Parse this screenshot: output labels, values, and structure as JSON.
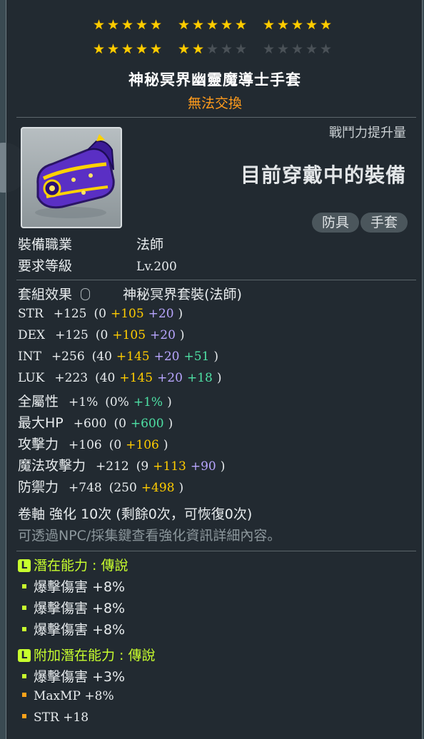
{
  "item": {
    "stars_row1": [
      true,
      true,
      true,
      true,
      true,
      true,
      true,
      true,
      true,
      true,
      true,
      true,
      true,
      true,
      true
    ],
    "stars_row2": [
      true,
      true,
      true,
      true,
      true,
      true,
      true,
      false,
      false,
      false,
      false,
      false,
      false,
      false,
      false
    ],
    "name": "神秘冥界幽靈魔導士手套",
    "trade_status": "無法交換",
    "combat_power_label": "戰鬥力提升量",
    "equipped_label": "目前穿戴中的裝備",
    "tags": [
      "防具",
      "手套"
    ],
    "job_label": "裝備職業",
    "job_value": "法師",
    "level_label": "要求等級",
    "level_value": "Lv.200",
    "set_label": "套組效果",
    "set_value": "神秘冥界套裝(法師)"
  },
  "stats": [
    {
      "name": "STR",
      "total": "+125",
      "base": "(0",
      "a": "+105",
      "b": "+20",
      "c": "",
      "end": ")"
    },
    {
      "name": "DEX",
      "total": "+125",
      "base": "(0",
      "a": "+105",
      "b": "+20",
      "c": "",
      "end": ")"
    },
    {
      "name": "INT",
      "total": "+256",
      "base": "(40",
      "a": "+145",
      "b": "+20",
      "c": "+51",
      "end": ")"
    },
    {
      "name": "LUK",
      "total": "+223",
      "base": "(40",
      "a": "+145",
      "b": "+20",
      "c": "+18",
      "end": ")"
    },
    {
      "name": "全屬性",
      "total": "+1%",
      "base": "(0%",
      "a": "",
      "b": "",
      "c": "+1%",
      "end": ")"
    },
    {
      "name": "最大HP",
      "total": "+600",
      "base": "(0",
      "a": "",
      "b": "",
      "c": "+600",
      "end": ")"
    },
    {
      "name": "攻擊力",
      "total": "+106",
      "base": "(0",
      "a": "+106",
      "b": "",
      "c": "",
      "end": ")"
    },
    {
      "name": "魔法攻擊力",
      "total": "+212",
      "base": "(9",
      "a": "+113",
      "b": "+90",
      "c": "",
      "end": ")"
    },
    {
      "name": "防禦力",
      "total": "+748",
      "base": "(250",
      "a": "+498",
      "b": "",
      "c": "",
      "end": ")"
    }
  ],
  "scroll": {
    "line": "卷軸 強化 10次 (剩餘0次，可恢復0次)",
    "hint": "可透過NPC/採集鍵查看強化資訊詳細內容。"
  },
  "potential": {
    "badge": "L",
    "title": "潛在能力 : 傳說",
    "lines": [
      "爆擊傷害 +8%",
      "爆擊傷害 +8%",
      "爆擊傷害 +8%"
    ]
  },
  "additional_potential": {
    "badge": "L",
    "title": "附加潛在能力 : 傳說",
    "lines": [
      "爆擊傷害 +3%",
      "MaxMP +8%",
      "STR +18"
    ]
  },
  "colors": {
    "star_on": "#ffcc00",
    "trade": "#ff9b1c",
    "potential": "#c8ff2e"
  }
}
